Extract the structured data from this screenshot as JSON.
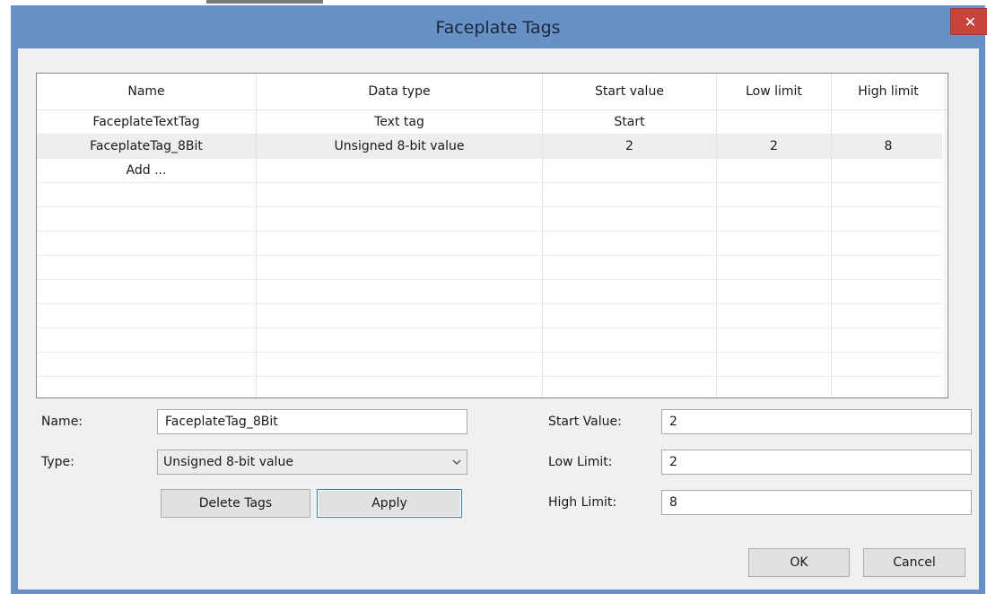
{
  "dialog": {
    "title": "Faceplate Tags",
    "close_glyph": "✕"
  },
  "table": {
    "columns": [
      "Name",
      "Data type",
      "Start value",
      "Low limit",
      "High limit"
    ],
    "rows": [
      {
        "name": "FaceplateTextTag",
        "data_type": "Text tag",
        "start": "Start",
        "low": "",
        "high": ""
      },
      {
        "name": "FaceplateTag_8Bit",
        "data_type": "Unsigned 8-bit value",
        "start": "2",
        "low": "2",
        "high": "8"
      },
      {
        "name": "Add ...",
        "data_type": "",
        "start": "",
        "low": "",
        "high": ""
      }
    ],
    "selected_row": 1
  },
  "form": {
    "name_label": "Name:",
    "name_value": "FaceplateTag_8Bit",
    "type_label": "Type:",
    "type_value": "Unsigned 8-bit value",
    "start_label": "Start Value:",
    "start_value": "2",
    "low_label": "Low Limit:",
    "low_value": "2",
    "high_label": "High Limit:",
    "high_value": "8"
  },
  "buttons": {
    "delete": "Delete Tags",
    "apply": "Apply",
    "ok": "OK",
    "cancel": "Cancel"
  },
  "colors": {
    "title_bar": "#6790c7",
    "close_button": "#c7443a",
    "client": "#f0f0f0",
    "selected_row": "#eeeeee"
  }
}
